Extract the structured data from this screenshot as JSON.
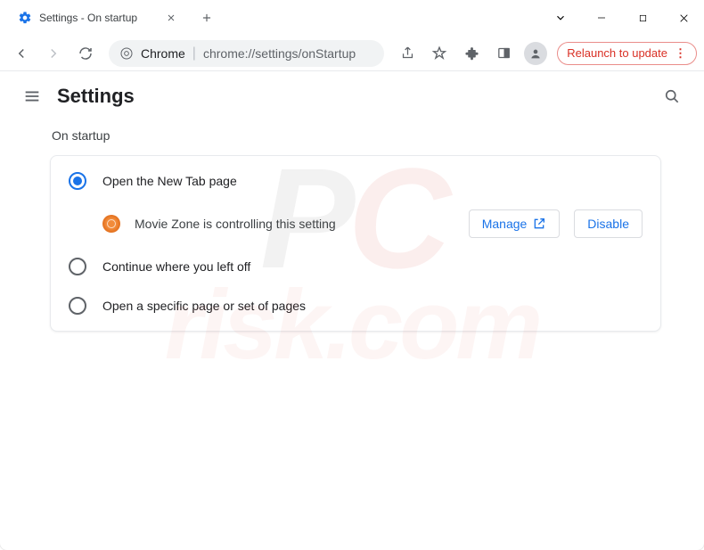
{
  "tab": {
    "title": "Settings - On startup"
  },
  "omnibox": {
    "prefix": "Chrome",
    "url": "chrome://settings/onStartup"
  },
  "relaunch": {
    "label": "Relaunch to update"
  },
  "appbar": {
    "title": "Settings"
  },
  "section": {
    "title": "On startup"
  },
  "options": {
    "open_new_tab": "Open the New Tab page",
    "continue": "Continue where you left off",
    "specific": "Open a specific page or set of pages"
  },
  "extension": {
    "name": "Movie Zone",
    "message": "Movie Zone is controlling this setting",
    "manage": "Manage",
    "disable": "Disable"
  },
  "watermark": {
    "line1": "risk.com"
  }
}
